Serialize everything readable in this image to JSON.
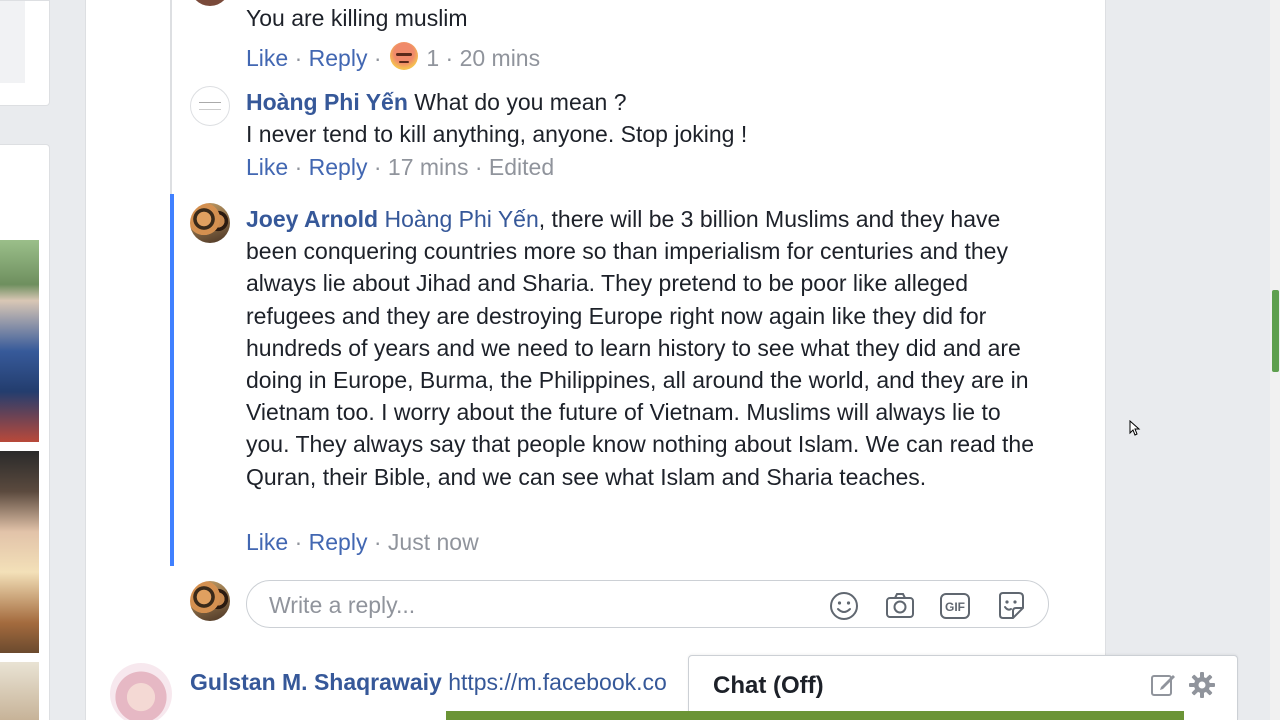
{
  "comments": [
    {
      "text": "You are killing muslim",
      "like": "Like",
      "reply": "Reply",
      "reaction_icon": "angry-reaction-icon",
      "reaction_count": "1",
      "time": "20 mins"
    },
    {
      "author": "Hoàng Phi Yến",
      "line1": "What do you mean ?",
      "line2": "I never tend to kill anything, anyone. Stop joking !",
      "like": "Like",
      "reply": "Reply",
      "time": "17 mins",
      "edited": "Edited"
    },
    {
      "author": "Joey Arnold",
      "mention": "Hoàng Phi Yến",
      "text": ", there will be 3 billion Muslims and they have been conquering countries more so than imperialism for centuries and they always lie about Jihad and Sharia. They pretend to be poor like alleged refugees and they are destroying Europe right now again like they did for hundreds of years and we need to learn history to see what they did and are doing in Europe, Burma, the Philippines, all around the world, and they are in Vietnam too. I worry about the future of Vietnam. Muslims will always lie to you. They always say that people know nothing about Islam. We can read the Quran, their Bible, and we can see what Islam and Sharia teaches.",
      "like": "Like",
      "reply": "Reply",
      "time": "Just now"
    }
  ],
  "reply_box": {
    "placeholder": "Write a reply..."
  },
  "next_post": {
    "author": "Gulstan M. Shaqrawaiy",
    "link": "https://m.facebook.co"
  },
  "chat": {
    "label": "Chat (Off)"
  },
  "separator": "·",
  "colors": {
    "link_blue": "#365899",
    "action_blue": "#4267b2",
    "meta_gray": "#90949c",
    "highlight_bar": "#4080ff",
    "scroll_thumb": "#5fa04e"
  }
}
